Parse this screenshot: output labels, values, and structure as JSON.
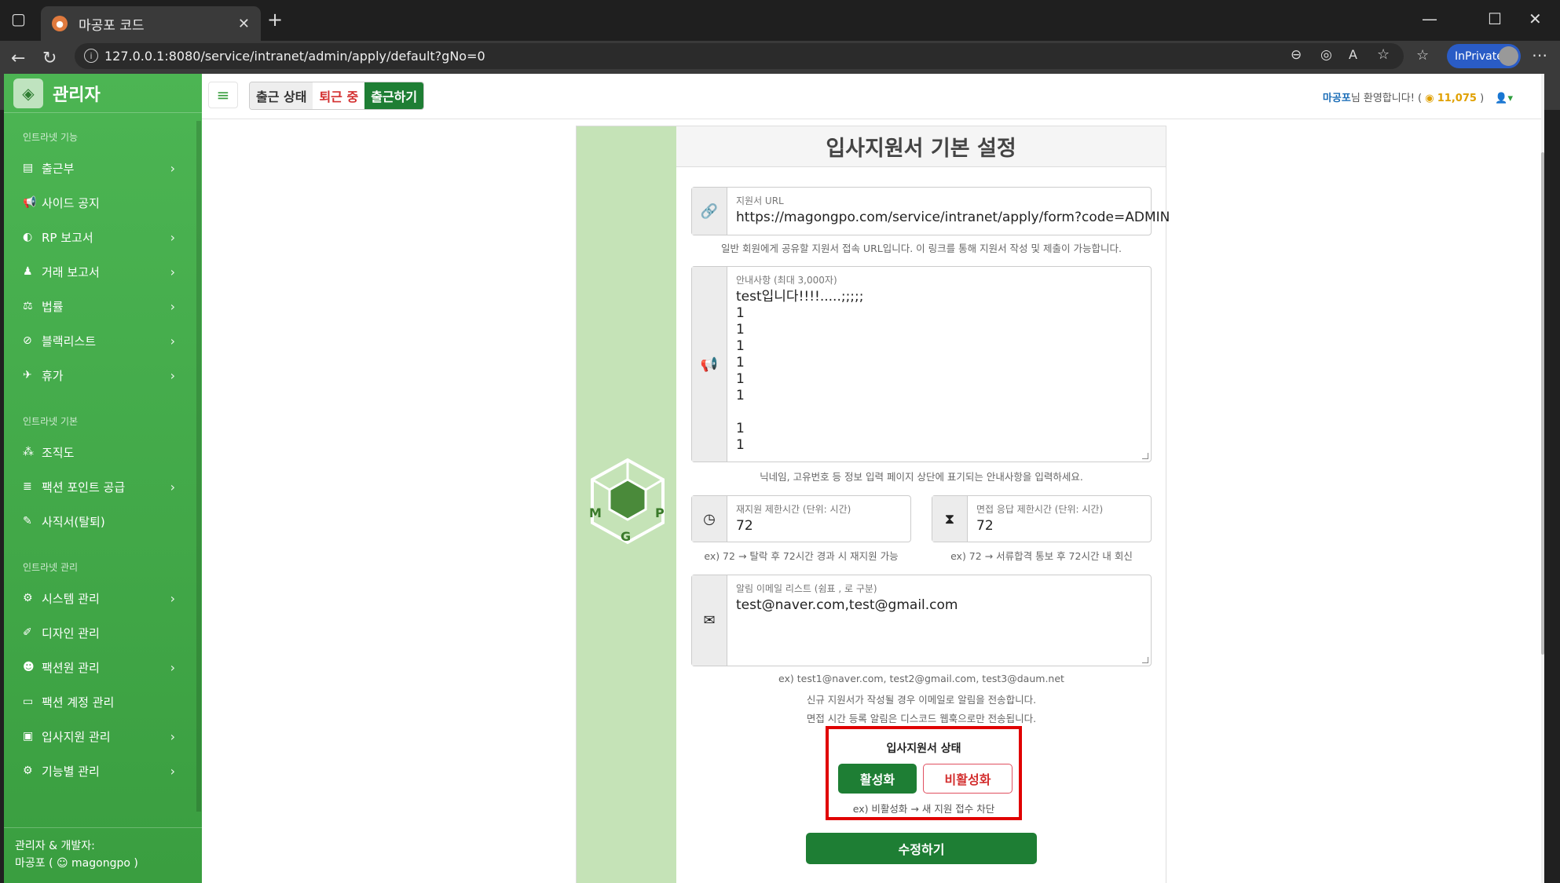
{
  "browser": {
    "tab_title": "마공포 코드",
    "url": "127.0.0.1:8080/service/intranet/admin/apply/default?gNo=0",
    "inprivate_label": "InPrivate"
  },
  "sidebar": {
    "brand": "관리자",
    "sections": [
      {
        "title": "인트라넷 기능",
        "items": [
          {
            "icon": "book-icon",
            "label": "출근부",
            "chevron": true
          },
          {
            "icon": "megaphone-icon",
            "label": "사이드 공지",
            "chevron": false
          },
          {
            "icon": "toggle-icon",
            "label": "RP 보고서",
            "chevron": true
          },
          {
            "icon": "user-icon",
            "label": "거래 보고서",
            "chevron": true
          },
          {
            "icon": "scale-icon",
            "label": "법률",
            "chevron": true
          },
          {
            "icon": "ban-icon",
            "label": "블랙리스트",
            "chevron": true
          },
          {
            "icon": "plane-icon",
            "label": "휴가",
            "chevron": true
          }
        ]
      },
      {
        "title": "인트라넷 기본",
        "items": [
          {
            "icon": "sitemap-icon",
            "label": "조직도",
            "chevron": false
          },
          {
            "icon": "coins-icon",
            "label": "팩션 포인트 공급",
            "chevron": true
          },
          {
            "icon": "pen-icon",
            "label": "사직서(탈퇴)",
            "chevron": false
          }
        ]
      },
      {
        "title": "인트라넷 관리",
        "items": [
          {
            "icon": "gear-icon",
            "label": "시스템 관리",
            "chevron": true
          },
          {
            "icon": "brush-icon",
            "label": "디자인 관리",
            "chevron": false
          },
          {
            "icon": "users-gear-icon",
            "label": "팩션원 관리",
            "chevron": true
          },
          {
            "icon": "id-card-icon",
            "label": "팩션 계정 관리",
            "chevron": false
          },
          {
            "icon": "clipboard-icon",
            "label": "입사지원 관리",
            "chevron": true
          },
          {
            "icon": "gears-icon",
            "label": "기능별 관리",
            "chevron": true
          }
        ]
      }
    ],
    "footer_line1": "관리자 & 개발자:",
    "footer_line2": "마공포 ( ☺ magongpo )"
  },
  "header": {
    "attendance_label": "출근 상태",
    "attendance_state": "퇴근 중",
    "checkin_button": "출근하기",
    "welcome_name": "마공포",
    "welcome_text": "님 환영합니다! (",
    "points": "11,075",
    "welcome_close": ")"
  },
  "form": {
    "title": "입사지원서 기본 설정",
    "url_label": "지원서 URL",
    "url_value": "https://magongpo.com/service/intranet/apply/form?code=ADMIN",
    "url_hint": "일반 회원에게 공유할 지원서 접속 URL입니다. 이 링크를 통해 지원서 작성 및 제출이 가능합니다.",
    "notice_label": "안내사항 (최대 3,000자)",
    "notice_value": "test입니다!!!!.....;;;;;\n1\n1\n1\n1\n1\n1\n\n1\n1",
    "notice_hint": "닉네임, 고유번호 등 정보 입력 페이지 상단에 표기되는 안내사항을 입력하세요.",
    "reapply_label": "재지원 제한시간 (단위: 시간)",
    "reapply_value": "72",
    "reapply_hint": "ex) 72 → 탈락 후 72시간 경과 시 재지원 가능",
    "interview_label": "면접 응답 제한시간 (단위: 시간)",
    "interview_value": "72",
    "interview_hint": "ex) 72 → 서류합격 통보 후 72시간 내 회신",
    "email_label": "알림 이메일 리스트 (쉼표 , 로 구분)",
    "email_value": "test@naver.com,test@gmail.com",
    "email_hint1": "ex) test1@naver.com, test2@gmail.com, test3@daum.net",
    "email_hint2": "신규 지원서가 작성될 경우 이메일로 알림을 전송합니다.",
    "email_hint3": "면접 시간 등록 알림은 디스코드 웹훅으로만 전송됩니다.",
    "status_title": "입사지원서 상태",
    "status_on": "활성화",
    "status_off": "비활성화",
    "status_hint": "ex) 비활성화 → 새 지원 접수 차단",
    "submit_label": "수정하기"
  }
}
